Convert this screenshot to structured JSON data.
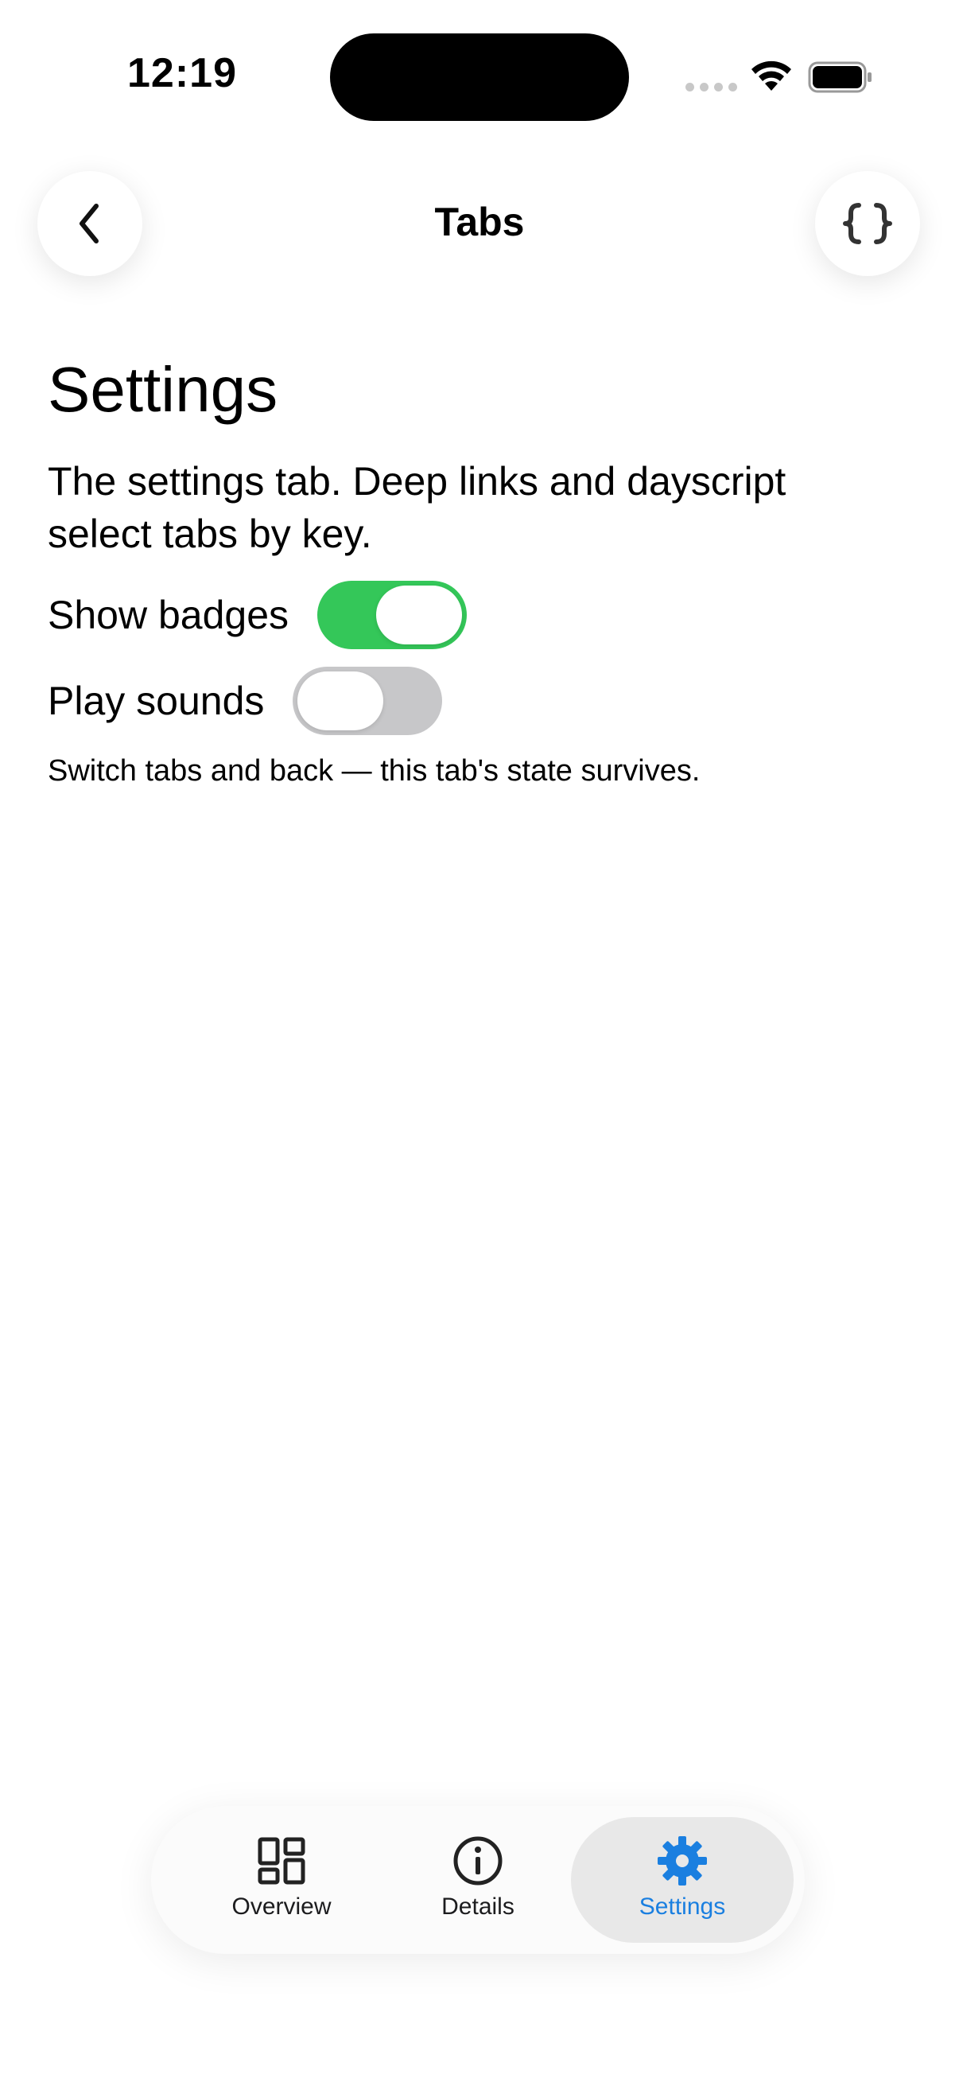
{
  "status_bar": {
    "time": "12:19"
  },
  "header": {
    "title": "Tabs",
    "back_icon": "chevron-left-icon",
    "code_icon": "braces-icon"
  },
  "content": {
    "heading": "Settings",
    "description": "The settings tab. Deep links and dayscript select tabs by key.",
    "toggles": [
      {
        "label": "Show badges",
        "on": true
      },
      {
        "label": "Play sounds",
        "on": false
      }
    ],
    "note": "Switch tabs and back — this tab's state survives."
  },
  "tab_bar": {
    "tabs": [
      {
        "label": "Overview",
        "icon": "grid-icon",
        "selected": false
      },
      {
        "label": "Details",
        "icon": "info-icon",
        "selected": false
      },
      {
        "label": "Settings",
        "icon": "gear-icon",
        "selected": true
      }
    ]
  },
  "colors": {
    "toggle_on": "#34c759",
    "toggle_off": "#c7c7c9",
    "accent": "#1a7fe0"
  }
}
